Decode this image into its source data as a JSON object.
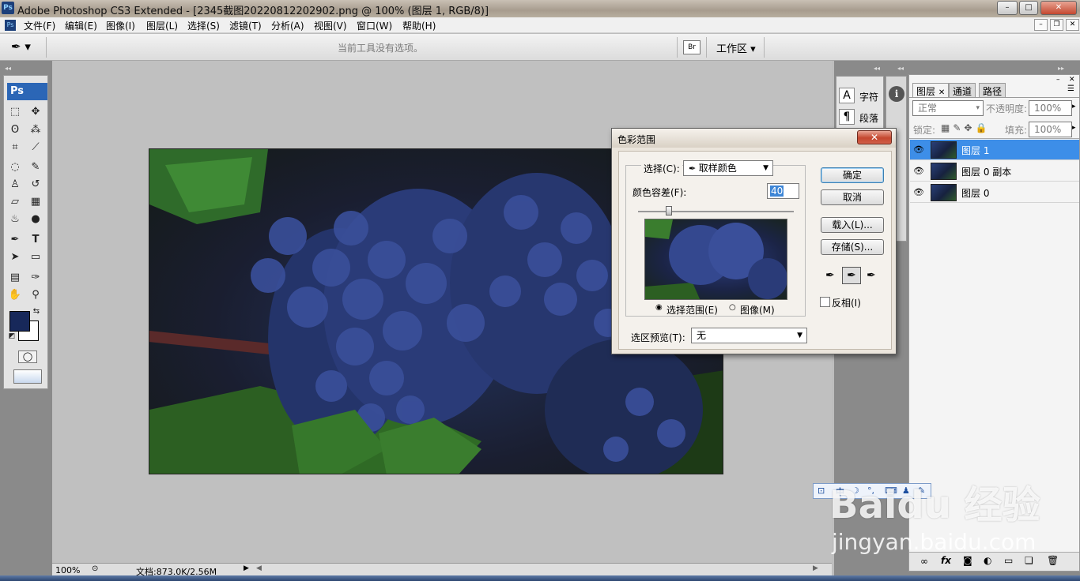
{
  "window": {
    "title": "Adobe Photoshop CS3 Extended - [2345截图20220812202902.png @ 100% (图层 1, RGB/8)]",
    "minimize": "–",
    "maximize": "□",
    "close": "✕"
  },
  "menu": [
    "文件(F)",
    "编辑(E)",
    "图像(I)",
    "图层(L)",
    "选择(S)",
    "滤镜(T)",
    "分析(A)",
    "视图(V)",
    "窗口(W)",
    "帮助(H)"
  ],
  "options_bar": {
    "hint": "当前工具没有选项。",
    "workspace": "工作区 ▾",
    "tool_icon": "eyedropper-icon"
  },
  "toolbox": {
    "logo": "Ps",
    "foreground_color": "#17285a",
    "background_color": "#ffffff"
  },
  "status": {
    "zoom": "100%",
    "doc": "文档:873.0K/2.56M"
  },
  "panels": {
    "char_label": "字符",
    "para_label": "段落",
    "layers_tabs": [
      "图层",
      "通道",
      "路径"
    ],
    "blend_mode": "正常",
    "opacity_label": "不透明度:",
    "opacity_value": "100%",
    "lock_label": "锁定:",
    "fill_label": "填充:",
    "fill_value": "100%",
    "layers": [
      {
        "name": "图层 1",
        "selected": true
      },
      {
        "name": "图层 0 副本",
        "selected": false
      },
      {
        "name": "图层 0",
        "selected": false
      }
    ]
  },
  "dialog": {
    "title": "色彩范围",
    "select_label": "选择(C):",
    "select_value": "取样颜色",
    "fuzziness_label": "颜色容差(F):",
    "fuzziness_value": "40",
    "radio_selection": "选择范围(E)",
    "radio_image": "图像(M)",
    "preview_label": "选区预览(T):",
    "preview_value": "无",
    "ok": "确定",
    "cancel": "取消",
    "load": "载入(L)...",
    "save": "存储(S)...",
    "invert": "反相(I)"
  },
  "watermark": {
    "brand": "Baidu 经验",
    "url": "jingyan.baidu.com"
  },
  "ime": {
    "lang": "中"
  }
}
